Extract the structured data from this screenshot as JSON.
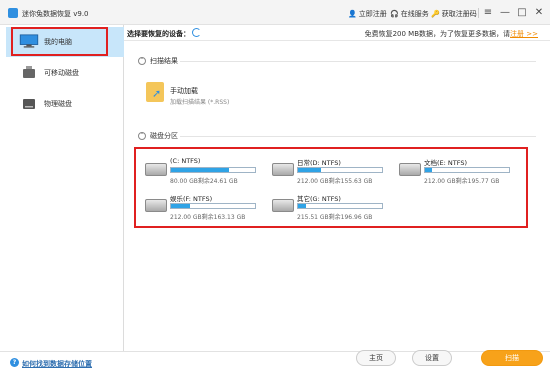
{
  "app": {
    "title": "迷你兔数据恢复 v9.0"
  },
  "titlebar": {
    "register": "立即注册",
    "online_service": "在线服务",
    "get_code": "获取注册码"
  },
  "sidebar": {
    "items": [
      {
        "label": "我的电脑",
        "icon": "monitor-icon"
      },
      {
        "label": "可移动磁盘",
        "icon": "usb-drive-icon"
      },
      {
        "label": "物理磁盘",
        "icon": "hard-disk-icon"
      }
    ]
  },
  "header": {
    "select_label": "选择要恢复的设备：",
    "note": "免费恢复200 MB数据，为了恢复更多数据，请",
    "note_link": "注册 >>"
  },
  "scan_results": {
    "title": "扫描结果",
    "manual_load": "手动加载",
    "manual_load_sub": "加载扫描结果 (*.RSS)"
  },
  "partitions": {
    "title": "磁盘分区",
    "items": [
      {
        "name": "(C: NTFS)",
        "info": "80.00 GB剩余24.61 GB",
        "used": 0.69
      },
      {
        "name": "日常(D: NTFS)",
        "info": "212.00 GB剩余155.63 GB",
        "used": 0.27
      },
      {
        "name": "文档(E: NTFS)",
        "info": "212.00 GB剩余195.77 GB",
        "used": 0.08
      },
      {
        "name": "娱乐(F: NTFS)",
        "info": "212.00 GB剩余163.13 GB",
        "used": 0.23
      },
      {
        "name": "其它(G: NTFS)",
        "info": "215.51 GB剩余196.96 GB",
        "used": 0.09
      }
    ]
  },
  "footer": {
    "help_link": "如何找到数据存储位置",
    "home": "主页",
    "settings": "设置",
    "scan": "扫描"
  },
  "colors": {
    "accent": "#2f8fe0",
    "scan_button": "#f7a21a",
    "highlight_box": "#e02020",
    "active_nav": "#c8e6fa"
  }
}
